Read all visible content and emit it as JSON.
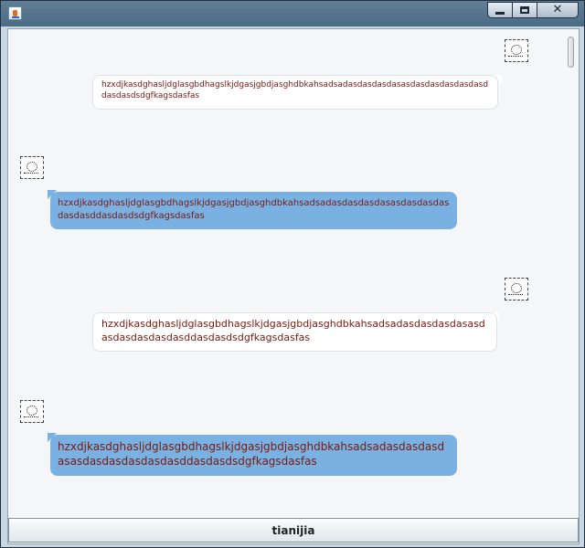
{
  "window": {
    "title": "",
    "controls": {
      "minimize": "minimize",
      "maximize": "maximize",
      "close": "✕"
    }
  },
  "messages": [
    {
      "side": "right",
      "style": "white",
      "text": "hzxdjkasdghasljdglasgbdhagslkjdgasjgbdjasghdbkahsadsadasdasdasdasasdasdasdasdasdasddasdasdsdgfkagsdasfas"
    },
    {
      "side": "left",
      "style": "blue",
      "text": "hzxdjkasdghasljdglasgbdhagslkjdgasjgbdjasghdbkahsadsadasdasdasdasasdasdasdasdasdasddasdasdsdgfkagsdasfas"
    },
    {
      "side": "right",
      "style": "white",
      "text": "hzxdjkasdghasljdglasgbdhagslkjdgasjgbdjasghdbkahsadsadasdasdasdasasdasdasdasdasdasddasdasdsdgfkagsdasfas"
    },
    {
      "side": "left",
      "style": "blue",
      "text": "hzxdjkasdghasljdglasgbdhagslkjdgasjgbdjasghdbkahsadsadasdasdasdasasdasdasdasdasdasddasdasdsdgfkagsdasfas"
    }
  ],
  "add_button": {
    "label": "tianijia"
  },
  "colors": {
    "blue_bubble": "#7ab1e3",
    "text": "#7a1a0f",
    "chat_bg": "#f4f6f8"
  }
}
